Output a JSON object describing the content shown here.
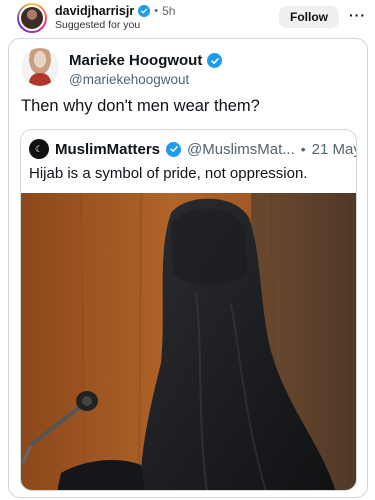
{
  "header": {
    "username": "davidjharrisjr",
    "separator": "•",
    "time": "5h",
    "subtitle": "Suggested for you",
    "follow_label": "Follow",
    "more_label": "···"
  },
  "tweet": {
    "author_name": "Marieke Hoogwout",
    "author_handle": "@mariekehoogwout",
    "text": "Then why don't men wear them?",
    "quote": {
      "author_name": "MuslimMatters",
      "author_handle": "@MuslimsMat...",
      "separator": "•",
      "date": "21 May",
      "text": "Hijab is a symbol of pride, not oppression."
    }
  },
  "colors": {
    "verified": "#1d9bf0",
    "follow_bg": "#efefef",
    "handle_gray": "#536471",
    "border": "#cfd9de"
  },
  "icons": {
    "verified": "verified-check-icon",
    "more": "more-options-icon",
    "microphone": "microphone"
  }
}
